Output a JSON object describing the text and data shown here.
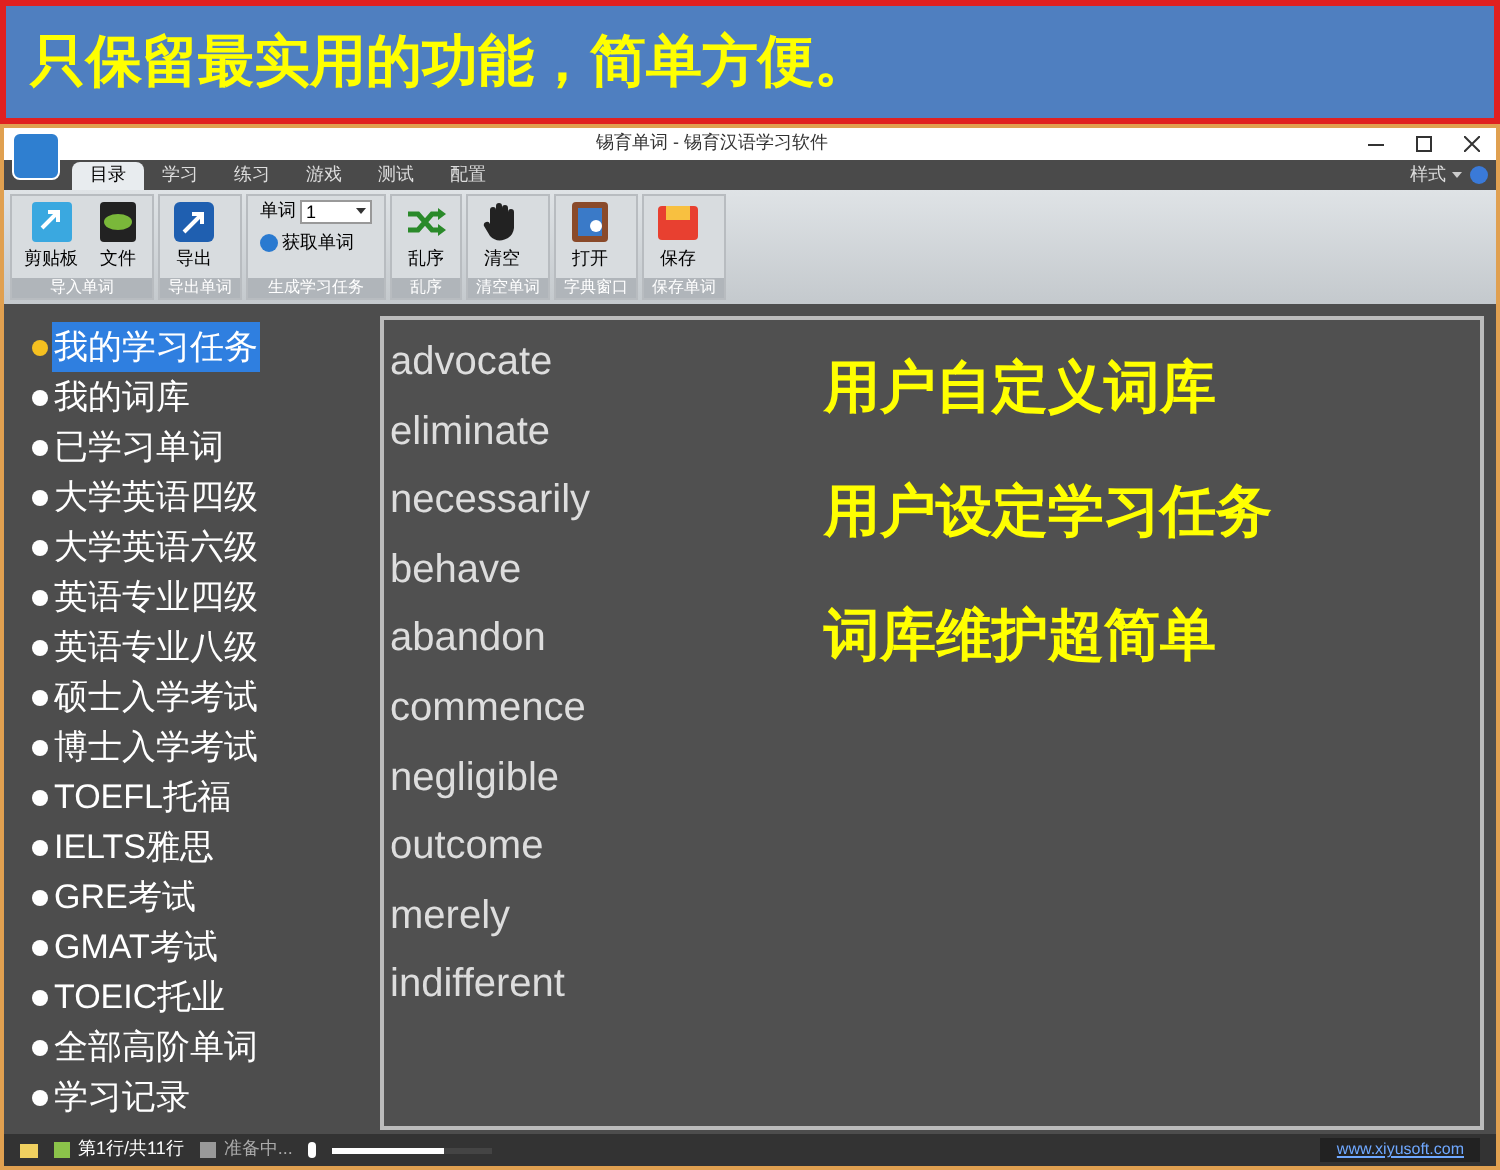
{
  "banner": {
    "text": "只保留最实用的功能，简单方便。"
  },
  "window": {
    "title": "锡育单词 - 锡育汉语学习软件",
    "style_menu": "样式"
  },
  "tabs": [
    {
      "label": "目录",
      "selected": true
    },
    {
      "label": "学习",
      "selected": false
    },
    {
      "label": "练习",
      "selected": false
    },
    {
      "label": "游戏",
      "selected": false
    },
    {
      "label": "测试",
      "selected": false
    },
    {
      "label": "配置",
      "selected": false
    }
  ],
  "ribbon_groups": [
    {
      "label": "导入单词",
      "buttons": [
        {
          "kind": "clipboard",
          "label": "剪贴板"
        },
        {
          "kind": "file",
          "label": "文件"
        }
      ]
    },
    {
      "label": "导出单词",
      "buttons": [
        {
          "kind": "export",
          "label": "导出"
        }
      ]
    },
    {
      "label": "生成学习任务",
      "kind": "task",
      "field_label": "单词",
      "field_value": "1",
      "action": "获取单词"
    },
    {
      "label": "乱序",
      "buttons": [
        {
          "kind": "shuffle",
          "label": "乱序"
        }
      ]
    },
    {
      "label": "清空单词",
      "buttons": [
        {
          "kind": "hand",
          "label": "清空"
        }
      ]
    },
    {
      "label": "字典窗口",
      "buttons": [
        {
          "kind": "book",
          "label": "打开"
        }
      ]
    },
    {
      "label": "保存单词",
      "buttons": [
        {
          "kind": "save",
          "label": "保存"
        }
      ]
    }
  ],
  "word_lists": [
    {
      "label": "我的学习任务",
      "selected": true
    },
    {
      "label": "我的词库",
      "selected": false
    },
    {
      "label": "已学习单词",
      "selected": false
    },
    {
      "label": "大学英语四级",
      "selected": false
    },
    {
      "label": "大学英语六级",
      "selected": false
    },
    {
      "label": "英语专业四级",
      "selected": false
    },
    {
      "label": "英语专业八级",
      "selected": false
    },
    {
      "label": "硕士入学考试",
      "selected": false
    },
    {
      "label": "博士入学考试",
      "selected": false
    },
    {
      "label": "TOEFL托福",
      "selected": false
    },
    {
      "label": "IELTS雅思",
      "selected": false
    },
    {
      "label": "GRE考试",
      "selected": false
    },
    {
      "label": "GMAT考试",
      "selected": false
    },
    {
      "label": "TOEIC托业",
      "selected": false
    },
    {
      "label": "全部高阶单词",
      "selected": false
    },
    {
      "label": "学习记录",
      "selected": false
    }
  ],
  "words": [
    "advocate",
    "eliminate",
    "necessarily",
    "behave",
    "abandon",
    "commence",
    "negligible",
    "outcome",
    "merely",
    "indifferent"
  ],
  "callouts": [
    "用户自定义词库",
    "用户设定学习任务",
    "词库维护超简单"
  ],
  "status_bar": {
    "position": "第1行/共11行",
    "status": "准备中...",
    "level": 0.7,
    "link": "www.xiyusoft.com"
  }
}
